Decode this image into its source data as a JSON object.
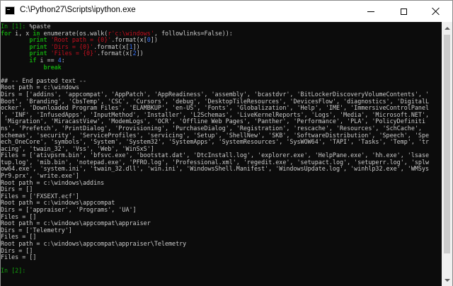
{
  "window": {
    "title": "C:\\Python27\\Scripts\\ipython.exe",
    "icon": "console-icon",
    "buttons": {
      "minimize": "minimize-icon",
      "maximize": "maximize-icon",
      "close": "close-icon"
    }
  },
  "colors": {
    "prompt": "#13a10e",
    "string": "#c50f1f",
    "text": "#cccccc",
    "number": "#3b78ff",
    "background": "#0c0c0c"
  },
  "console": {
    "lines": [
      [
        {
          "t": "In [1]: ",
          "c": "prompt"
        },
        {
          "t": "%paste",
          "c": "text"
        }
      ],
      [
        {
          "t": "for",
          "c": "kw"
        },
        {
          "t": " i, x ",
          "c": "text"
        },
        {
          "t": "in",
          "c": "kw"
        },
        {
          "t": " enumerate(os.walk(",
          "c": "text"
        },
        {
          "t": "r'c:\\windows'",
          "c": "str"
        },
        {
          "t": ", followlinks=False)):",
          "c": "text"
        }
      ],
      [
        {
          "t": "        print ",
          "c": "kw"
        },
        {
          "t": "'Root path = {0}'",
          "c": "str"
        },
        {
          "t": ".format(x[",
          "c": "text"
        },
        {
          "t": "0",
          "c": "num"
        },
        {
          "t": "])",
          "c": "text"
        }
      ],
      [
        {
          "t": "        print ",
          "c": "kw"
        },
        {
          "t": "'Dirs = {0}'",
          "c": "str"
        },
        {
          "t": ".format(x[",
          "c": "text"
        },
        {
          "t": "1",
          "c": "num"
        },
        {
          "t": "])",
          "c": "text"
        }
      ],
      [
        {
          "t": "        print ",
          "c": "kw"
        },
        {
          "t": "'Files = {0}'",
          "c": "str"
        },
        {
          "t": ".format(x[",
          "c": "text"
        },
        {
          "t": "2",
          "c": "num"
        },
        {
          "t": "])",
          "c": "text"
        }
      ],
      [
        {
          "t": "        if",
          "c": "kw"
        },
        {
          "t": " i == ",
          "c": "text"
        },
        {
          "t": "4",
          "c": "num"
        },
        {
          "t": ":",
          "c": "text"
        }
      ],
      [
        {
          "t": "            break",
          "c": "kw"
        }
      ],
      [],
      [
        {
          "t": "## -- End pasted text --",
          "c": "text"
        }
      ],
      [
        {
          "t": "Root path = c:\\windows",
          "c": "text"
        }
      ],
      [
        {
          "t": "Dirs = ['addins', 'appcompat', 'AppPatch', 'AppReadiness', 'assembly', 'bcastdvr', 'BitLockerDiscoveryVolumeContents', '",
          "c": "text"
        }
      ],
      [
        {
          "t": "Boot', 'Branding', 'CbsTemp', 'CSC', 'Cursors', 'debug', 'DesktopTileResources', 'DevicesFlow', 'diagnostics', 'DigitalL",
          "c": "text"
        }
      ],
      [
        {
          "t": "ocker', 'Downloaded Program Files', 'ELAMBKUP', 'en-US', 'Fonts', 'Globalization', 'Help', 'IME', 'ImmersiveControlPanel",
          "c": "text"
        }
      ],
      [
        {
          "t": "', 'INF', 'InfusedApps', 'InputMethod', 'Installer', 'L2Schemas', 'LiveKernelReports', 'Logs', 'Media', 'Microsoft.NET',",
          "c": "text"
        }
      ],
      [
        {
          "t": " 'Migration', 'MiracastView', 'ModemLogs', 'OCR', 'Offline Web Pages', 'Panther', 'Performance', 'PLA', 'PolicyDefiniti",
          "c": "text"
        }
      ],
      [
        {
          "t": "ns', 'Prefetch', 'PrintDialog', 'Provisioning', 'PurchaseDialog', 'Registration', 'rescache', 'Resources', 'SchCache',",
          "c": "text"
        }
      ],
      [
        {
          "t": "schemas', 'security', 'ServiceProfiles', 'servicing', 'Setup', 'ShellNew', 'SKB', 'SoftwareDistribution', 'Speech', 'Spe",
          "c": "text"
        }
      ],
      [
        {
          "t": "ech_OneCore', 'symbols', 'System', 'System32', 'SystemApps', 'SystemResources', 'SysWOW64', 'TAPI', 'Tasks', 'Temp', 'tr",
          "c": "text"
        }
      ],
      [
        {
          "t": "acing', 'twain_32', 'Vss', 'Web', 'WinSxS']",
          "c": "text"
        }
      ],
      [
        {
          "t": "Files = ['ativpsrm.bin', 'bfsvc.exe', 'bootstat.dat', 'DtcInstall.log', 'explorer.exe', 'HelpPane.exe', 'hh.exe', 'lsase",
          "c": "text"
        }
      ],
      [
        {
          "t": "tup.log', 'mib.bin', 'notepad.exe', 'PFRO.log', 'Professional.xml', 'regedit.exe', 'setupact.log', 'setuperr.log', 'splw",
          "c": "text"
        }
      ],
      [
        {
          "t": "ow64.exe', 'system.ini', 'twain_32.dll', 'win.ini', 'WindowsShell.Manifest', 'WindowsUpdate.log', 'winhlp32.exe', 'WMSys",
          "c": "text"
        }
      ],
      [
        {
          "t": "Pr9.prx', 'write.exe']",
          "c": "text"
        }
      ],
      [
        {
          "t": "Root path = c:\\windows\\addins",
          "c": "text"
        }
      ],
      [
        {
          "t": "Dirs = []",
          "c": "text"
        }
      ],
      [
        {
          "t": "Files = ['FXSEXT.ecf']",
          "c": "text"
        }
      ],
      [
        {
          "t": "Root path = c:\\windows\\appcompat",
          "c": "text"
        }
      ],
      [
        {
          "t": "Dirs = ['appraiser', 'Programs', 'UA']",
          "c": "text"
        }
      ],
      [
        {
          "t": "Files = []",
          "c": "text"
        }
      ],
      [
        {
          "t": "Root path = c:\\windows\\appcompat\\appraiser",
          "c": "text"
        }
      ],
      [
        {
          "t": "Dirs = ['Telemetry']",
          "c": "text"
        }
      ],
      [
        {
          "t": "Files = []",
          "c": "text"
        }
      ],
      [
        {
          "t": "Root path = c:\\windows\\appcompat\\appraiser\\Telemetry",
          "c": "text"
        }
      ],
      [
        {
          "t": "Dirs = []",
          "c": "text"
        }
      ],
      [
        {
          "t": "Files = []",
          "c": "text"
        }
      ],
      [],
      [
        {
          "t": "In [2]: ",
          "c": "prompt"
        }
      ]
    ]
  }
}
